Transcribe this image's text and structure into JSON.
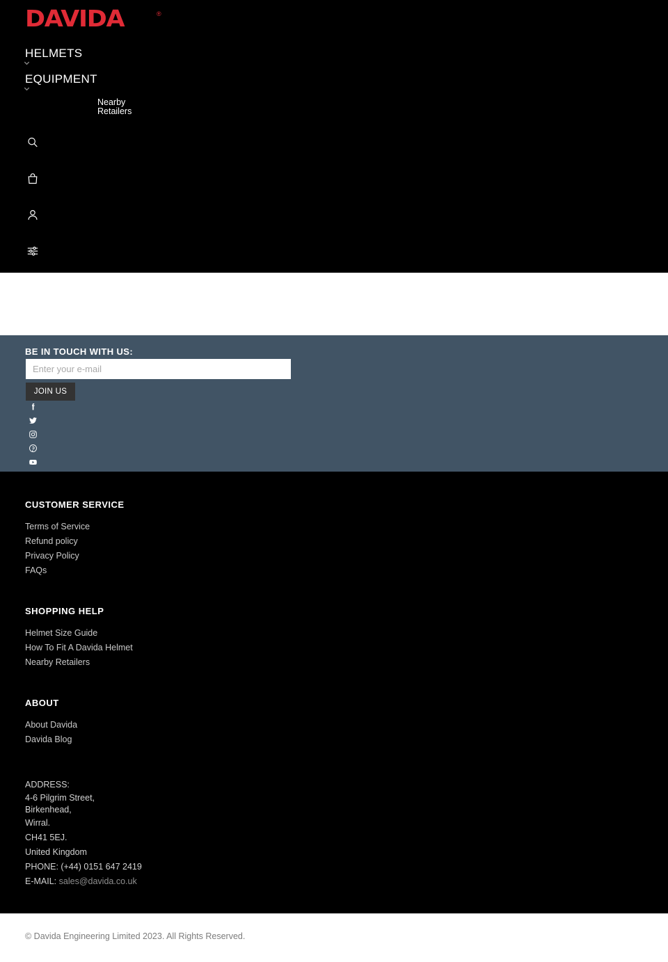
{
  "header": {
    "logo": {
      "text": "DAVIDA",
      "registered_mark": "®",
      "color": "#e02b36"
    },
    "nav_primary": [
      {
        "label": "HELMETS",
        "icon": "chevron-down-icon"
      },
      {
        "label": "EQUIPMENT",
        "icon": "chevron-down-icon"
      }
    ],
    "nav_secondary": {
      "line1": "Nearby",
      "line2": "Retailers"
    },
    "icons": [
      {
        "name": "search-icon",
        "label": "Search"
      },
      {
        "name": "shopping-bag-icon",
        "label": "Cart"
      },
      {
        "name": "user-account-icon",
        "label": "Account"
      },
      {
        "name": "sliders-filter-icon",
        "label": "Filters"
      }
    ],
    "background_color": "#000000"
  },
  "newsletter": {
    "title": "BE IN TOUCH WITH US:",
    "input_placeholder": "Enter your e-mail",
    "input_value": "",
    "button_label": "JOIN US",
    "background_color": "#415465",
    "socials": [
      {
        "name": "facebook-icon",
        "label": "Facebook"
      },
      {
        "name": "twitter-icon",
        "label": "Twitter"
      },
      {
        "name": "instagram-icon",
        "label": "Instagram"
      },
      {
        "name": "pinterest-icon",
        "label": "Pinterest"
      },
      {
        "name": "youtube-icon",
        "label": "YouTube"
      }
    ]
  },
  "footer": {
    "customer_service": {
      "heading": "CUSTOMER SERVICE",
      "links": [
        "Terms of Service",
        "Refund policy",
        "Privacy Policy",
        "FAQs"
      ]
    },
    "shopping_help": {
      "heading": "SHOPPING HELP",
      "links": [
        "Helmet Size Guide",
        "How To Fit A Davida Helmet",
        "Nearby Retailers"
      ]
    },
    "about": {
      "heading": "ABOUT",
      "links": [
        "About Davida",
        "Davida Blog"
      ]
    },
    "address": {
      "label": "ADDRESS:",
      "lines": [
        "4-6 Pilgrim Street,",
        "Birkenhead,",
        "Wirral.",
        "CH41 5EJ.",
        "United Kingdom"
      ],
      "phone": "PHONE: (+44) 0151 647 2419",
      "email_label": "E-MAIL:",
      "email": "sales@davida.co.uk"
    },
    "background_color": "#000000"
  },
  "copyright": {
    "text": "© Davida Engineering Limited 2023. All Rights Reserved."
  }
}
